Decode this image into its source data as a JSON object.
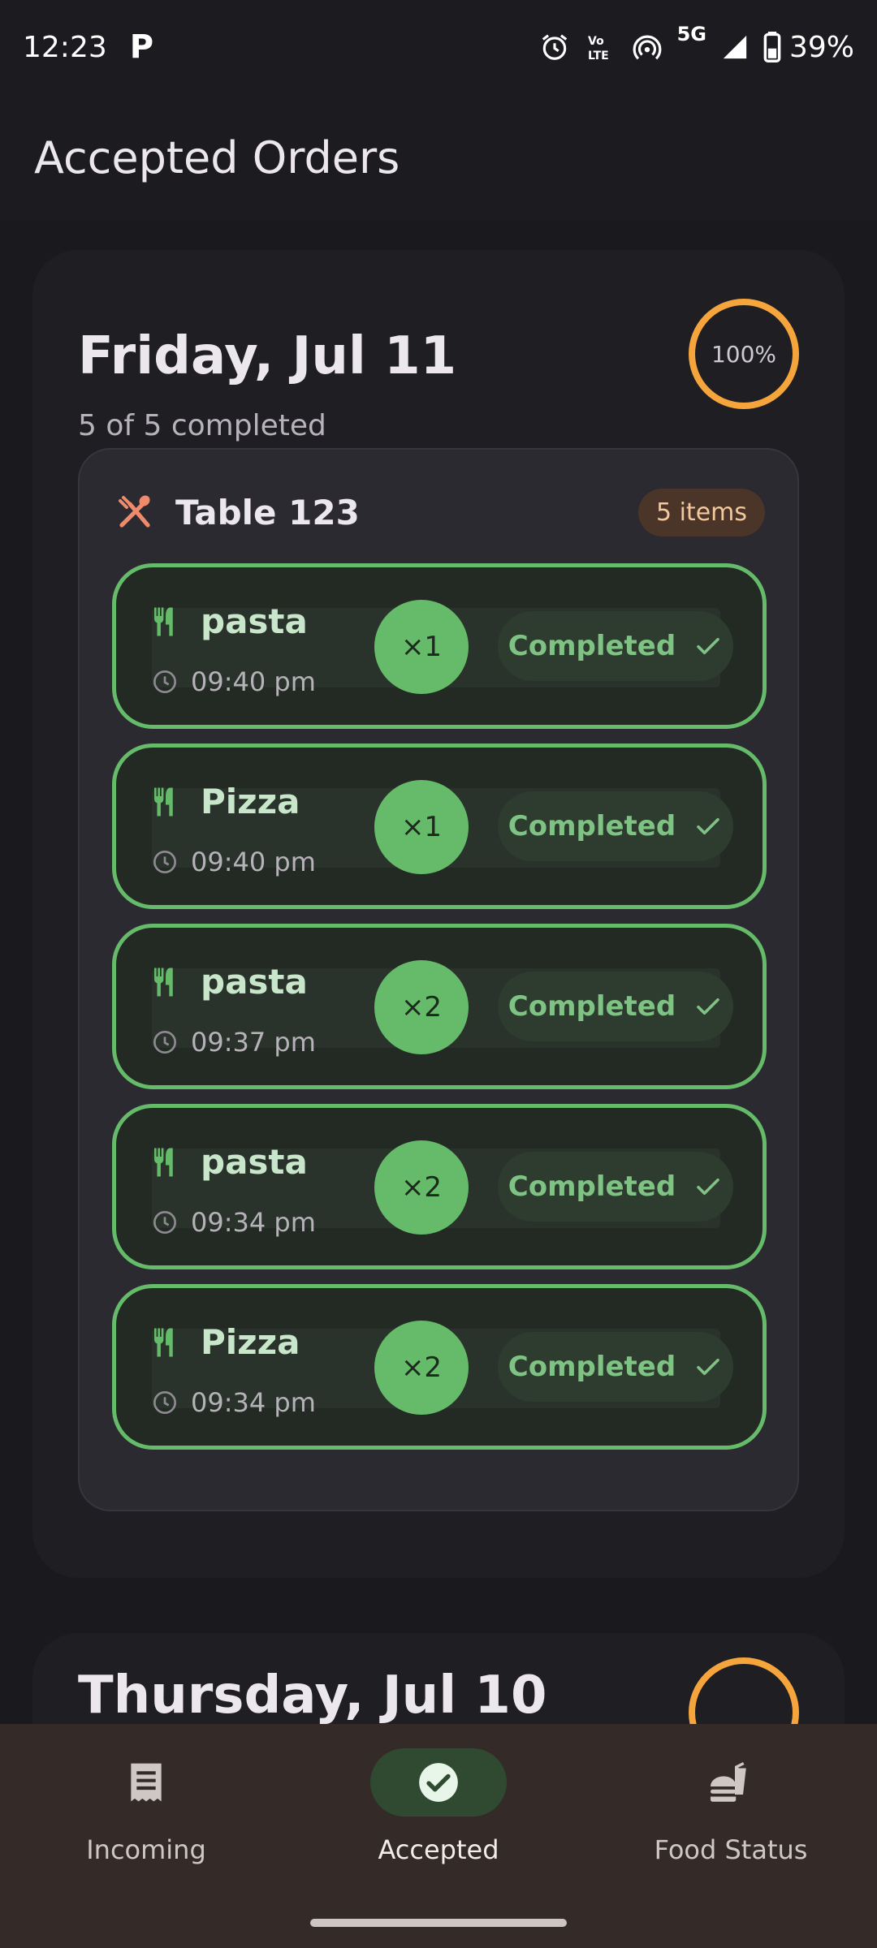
{
  "status_bar": {
    "time": "12:23",
    "app_indicator": "P",
    "battery": "39%",
    "network": "5G",
    "icons": [
      "alarm-icon",
      "volte-icon",
      "hotspot-icon",
      "5g-icon",
      "signal-icon",
      "battery-icon"
    ]
  },
  "app_bar": {
    "title": "Accepted Orders"
  },
  "days": [
    {
      "title": "Friday, Jul 11",
      "subtitle": "5 of 5 completed",
      "progress": "100%",
      "progress_value": 1.0,
      "table": {
        "name": "Table 123",
        "badge": "5 items",
        "items": [
          {
            "name": "pasta",
            "time": "09:40 pm",
            "qty": "×1",
            "status": "Completed"
          },
          {
            "name": "Pizza",
            "time": "09:40 pm",
            "qty": "×1",
            "status": "Completed"
          },
          {
            "name": "pasta",
            "time": "09:37 pm",
            "qty": "×2",
            "status": "Completed"
          },
          {
            "name": "pasta",
            "time": "09:34 pm",
            "qty": "×2",
            "status": "Completed"
          },
          {
            "name": "Pizza",
            "time": "09:34 pm",
            "qty": "×2",
            "status": "Completed"
          }
        ]
      }
    },
    {
      "title": "Thursday, Jul 10"
    }
  ],
  "bottom_nav": {
    "items": [
      {
        "label": "Incoming",
        "icon": "receipt-icon",
        "active": false
      },
      {
        "label": "Accepted",
        "icon": "check-circle-icon",
        "active": true
      },
      {
        "label": "Food Status",
        "icon": "fastfood-icon",
        "active": false
      }
    ]
  },
  "colors": {
    "accent_green": "#66bb6a",
    "progress_orange": "#f5a53b",
    "table_icon": "#f08a6b"
  }
}
